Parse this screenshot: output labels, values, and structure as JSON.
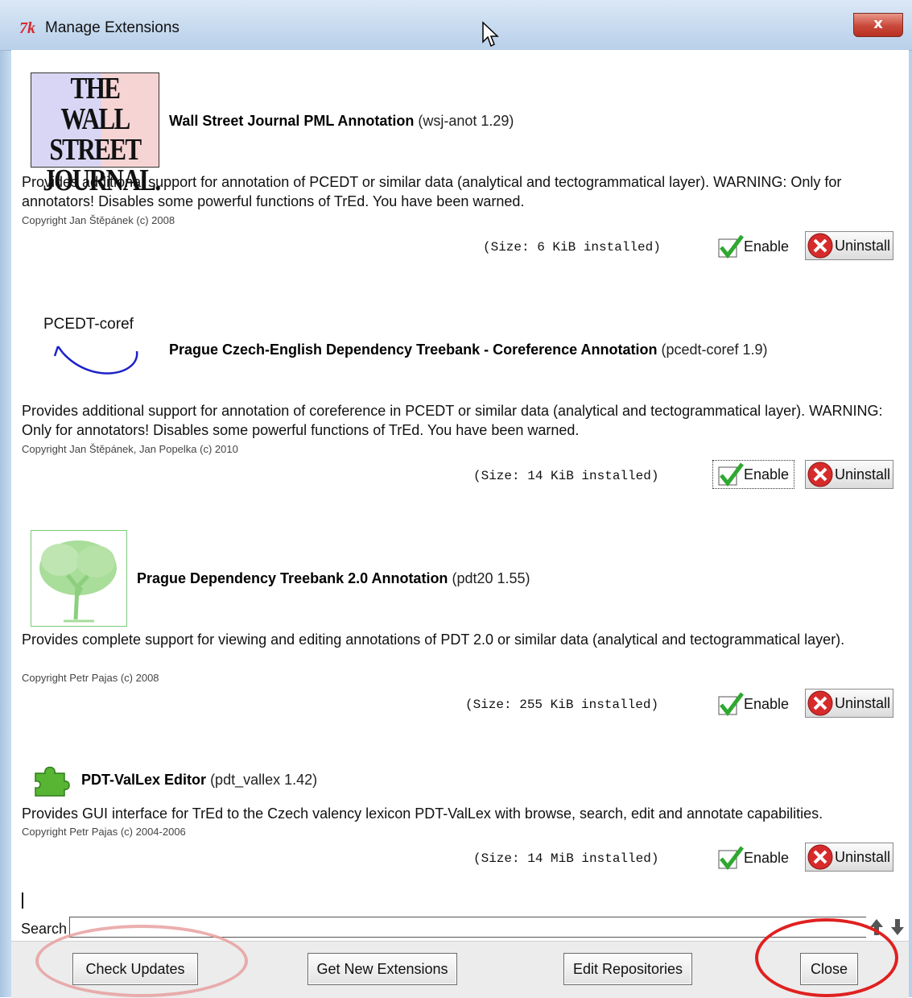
{
  "window": {
    "title": "Manage Extensions",
    "close_glyph": "x"
  },
  "extensions": [
    {
      "logo_text": [
        "THE WALL",
        "STREET",
        "JOURNAL."
      ],
      "name": "Wall Street Journal PML Annotation",
      "version": "(wsj-anot 1.29)",
      "description": "Provides additional support for annotation of PCEDT or similar data (analytical and tectogrammatical layer). WARNING: Only for annotators! Disables some powerful functions of TrEd. You have been warned.",
      "copyright": "Copyright Jan Štěpánek (c) 2008",
      "size": "(Size: 6 KiB installed)",
      "enable_label": "Enable",
      "uninstall_label": "Uninstall"
    },
    {
      "logo_text": "PCEDT-coref",
      "name": "Prague Czech-English Dependency Treebank - Coreference Annotation",
      "version": "(pcedt-coref 1.9)",
      "description": "Provides additional support for annotation of coreference in PCEDT or similar data (analytical and tectogrammatical layer). WARNING: Only for annotators! Disables some powerful functions of TrEd. You have been warned.",
      "copyright": "Copyright Jan Štěpánek, Jan Popelka (c) 2010",
      "size": "(Size: 14 KiB installed)",
      "enable_label": "Enable",
      "uninstall_label": "Uninstall"
    },
    {
      "name": "Prague Dependency Treebank 2.0 Annotation",
      "version": "(pdt20 1.55)",
      "description": "Provides complete support for viewing and editing annotations of PDT 2.0 or similar data (analytical and tectogrammatical layer).",
      "copyright": "Copyright Petr Pajas (c) 2008",
      "size": "(Size: 255 KiB installed)",
      "enable_label": "Enable",
      "uninstall_label": "Uninstall"
    },
    {
      "name": "PDT-ValLex Editor",
      "version": "(pdt_vallex 1.42)",
      "description": "Provides GUI interface for TrEd to the Czech valency lexicon PDT-ValLex with browse, search, edit and annotate capabilities.",
      "copyright": "Copyright Petr Pajas (c) 2004-2006",
      "size": "(Size: 14 MiB installed)",
      "enable_label": "Enable",
      "uninstall_label": "Uninstall"
    }
  ],
  "search": {
    "label": "Search",
    "value": ""
  },
  "buttons": {
    "check_updates": "Check Updates",
    "get_new_extensions": "Get New Extensions",
    "edit_repositories": "Edit Repositories",
    "close": "Close"
  },
  "colors": {
    "annotation_circle": "#e06a6a",
    "annotation_circle_right": "#e02020"
  }
}
